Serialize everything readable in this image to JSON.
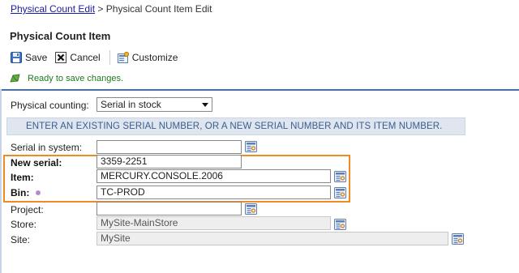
{
  "breadcrumb": {
    "link": "Physical Count Edit",
    "separator": ">",
    "current": "Physical Count Item Edit"
  },
  "page": {
    "title": "Physical Count Item"
  },
  "toolbar": {
    "save_label": "Save",
    "cancel_label": "Cancel",
    "customize_label": "Customize"
  },
  "status": {
    "message": "Ready to save changes."
  },
  "form": {
    "counting": {
      "label": "Physical counting:",
      "value": "Serial in stock"
    },
    "instructions": "ENTER AN EXISTING SERIAL NUMBER, OR A NEW SERIAL NUMBER AND ITS ITEM NUMBER.",
    "serial_in_system": {
      "label": "Serial in system:",
      "value": ""
    },
    "new_serial": {
      "label": "New serial:",
      "value": "3359-2251"
    },
    "item": {
      "label": "Item:",
      "value": "MERCURY.CONSOLE.2006"
    },
    "bin": {
      "label": "Bin:",
      "value": "TC-PROD"
    },
    "project": {
      "label": "Project:",
      "value": ""
    },
    "store": {
      "label": "Store:",
      "value": "MySite-MainStore"
    },
    "site": {
      "label": "Site:",
      "value": "MySite"
    }
  },
  "colors": {
    "highlight_border": "#f08a24",
    "status_text": "#1e7a1e",
    "banner_bg": "#dfe6ef",
    "banner_text": "#3a5d8f",
    "link": "#1a1aa6",
    "required_dot": "#b58ad6"
  },
  "icons": {
    "save": "floppy-disk-icon",
    "cancel": "close-icon",
    "customize": "customize-icon",
    "status": "pencil-ready-icon",
    "lookup": "lookup-icon"
  }
}
